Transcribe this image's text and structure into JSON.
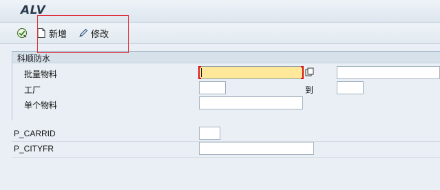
{
  "window": {
    "title": "ALV"
  },
  "toolbar": {
    "items": [
      {
        "icon": "execute-icon",
        "label": ""
      },
      {
        "icon": "new-document-icon",
        "label": "新增"
      },
      {
        "icon": "edit-pencil-icon",
        "label": "修改"
      }
    ]
  },
  "selection_block": {
    "title": "科顺防水",
    "fields": [
      {
        "label": "批量物料",
        "value": "",
        "to_value": "",
        "required": true,
        "focused": true
      },
      {
        "label": "工厂",
        "value": "",
        "range_label": "到",
        "to_value": ""
      },
      {
        "label": "单个物料",
        "value": ""
      }
    ]
  },
  "parameters": [
    {
      "label": "P_CARRID",
      "value": ""
    },
    {
      "label": "P_CITYFR",
      "value": ""
    }
  ],
  "colors": {
    "accent_highlight": "#e0303a",
    "focused_field": "#ffe89a",
    "required_marker": "#dd1111"
  }
}
